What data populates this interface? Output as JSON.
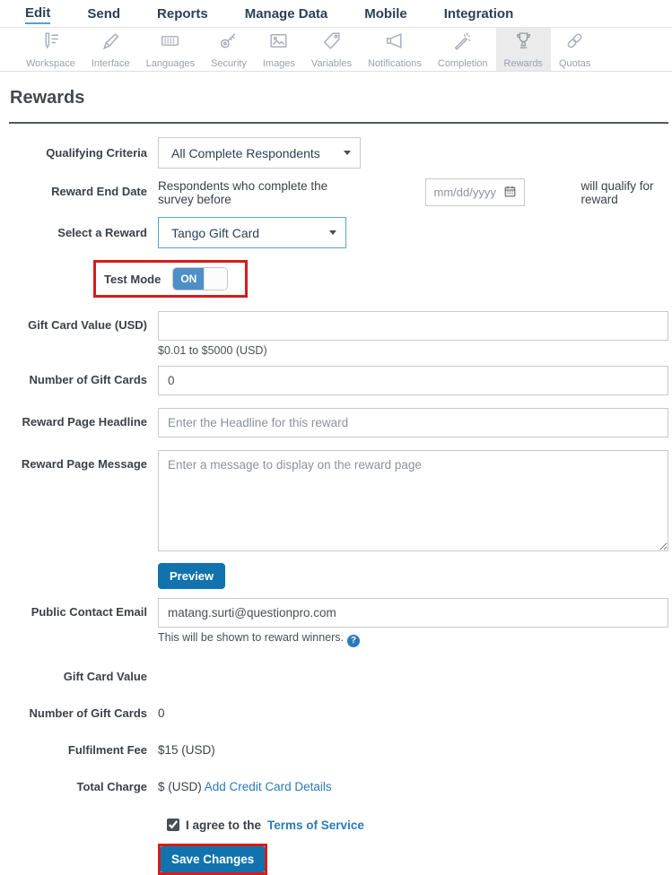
{
  "nav": {
    "items": [
      {
        "label": "Edit"
      },
      {
        "label": "Send"
      },
      {
        "label": "Reports"
      },
      {
        "label": "Manage Data"
      },
      {
        "label": "Mobile"
      },
      {
        "label": "Integration"
      }
    ],
    "active": "Edit"
  },
  "tabs": {
    "items": [
      {
        "label": "Workspace"
      },
      {
        "label": "Interface"
      },
      {
        "label": "Languages"
      },
      {
        "label": "Security"
      },
      {
        "label": "Images"
      },
      {
        "label": "Variables"
      },
      {
        "label": "Notifications"
      },
      {
        "label": "Completion"
      },
      {
        "label": "Rewards"
      },
      {
        "label": "Quotas"
      }
    ],
    "selected": "Rewards"
  },
  "page": {
    "title": "Rewards"
  },
  "form": {
    "qualifying_criteria": {
      "label": "Qualifying Criteria",
      "value": "All Complete Respondents"
    },
    "reward_end_date": {
      "label": "Reward End Date",
      "prefix": "Respondents who complete the survey before",
      "placeholder": "mm/dd/yyyy",
      "suffix": "will qualify for reward"
    },
    "select_reward": {
      "label": "Select a Reward",
      "value": "Tango Gift Card"
    },
    "test_mode": {
      "label": "Test Mode",
      "state": "ON"
    },
    "gift_card_value": {
      "label": "Gift Card Value (USD)",
      "value": "",
      "helper": "$0.01 to $5000 (USD)"
    },
    "number_of_gift_cards": {
      "label": "Number of Gift Cards",
      "value": "0"
    },
    "reward_page_headline": {
      "label": "Reward Page Headline",
      "placeholder": "Enter the Headline for this reward"
    },
    "reward_page_message": {
      "label": "Reward Page Message",
      "placeholder": "Enter a message to display on the reward page"
    },
    "preview_button_label": "Preview",
    "public_contact_email": {
      "label": "Public Contact Email",
      "value": "matang.surti@questionpro.com",
      "helper": "This will be shown to reward winners."
    },
    "summary_gift_card_value": {
      "label": "Gift Card Value",
      "value": ""
    },
    "summary_number_of_gift_cards": {
      "label": "Number of Gift Cards",
      "value": "0"
    },
    "fulfilment_fee": {
      "label": "Fulfilment Fee",
      "value": "$15 (USD)"
    },
    "total_charge": {
      "label": "Total Charge",
      "value": "$ (USD)",
      "link": "Add Credit Card Details"
    },
    "agree": {
      "text": "I agree to the",
      "link": "Terms of Service",
      "checked": true
    },
    "save_button_label": "Save Changes"
  },
  "colors": {
    "accent_blue": "#1173ad",
    "link_blue": "#2a7ab9",
    "toggle_blue": "#4d8fc6",
    "highlight_red": "#d51c1c",
    "nav_text": "#2c4156"
  }
}
